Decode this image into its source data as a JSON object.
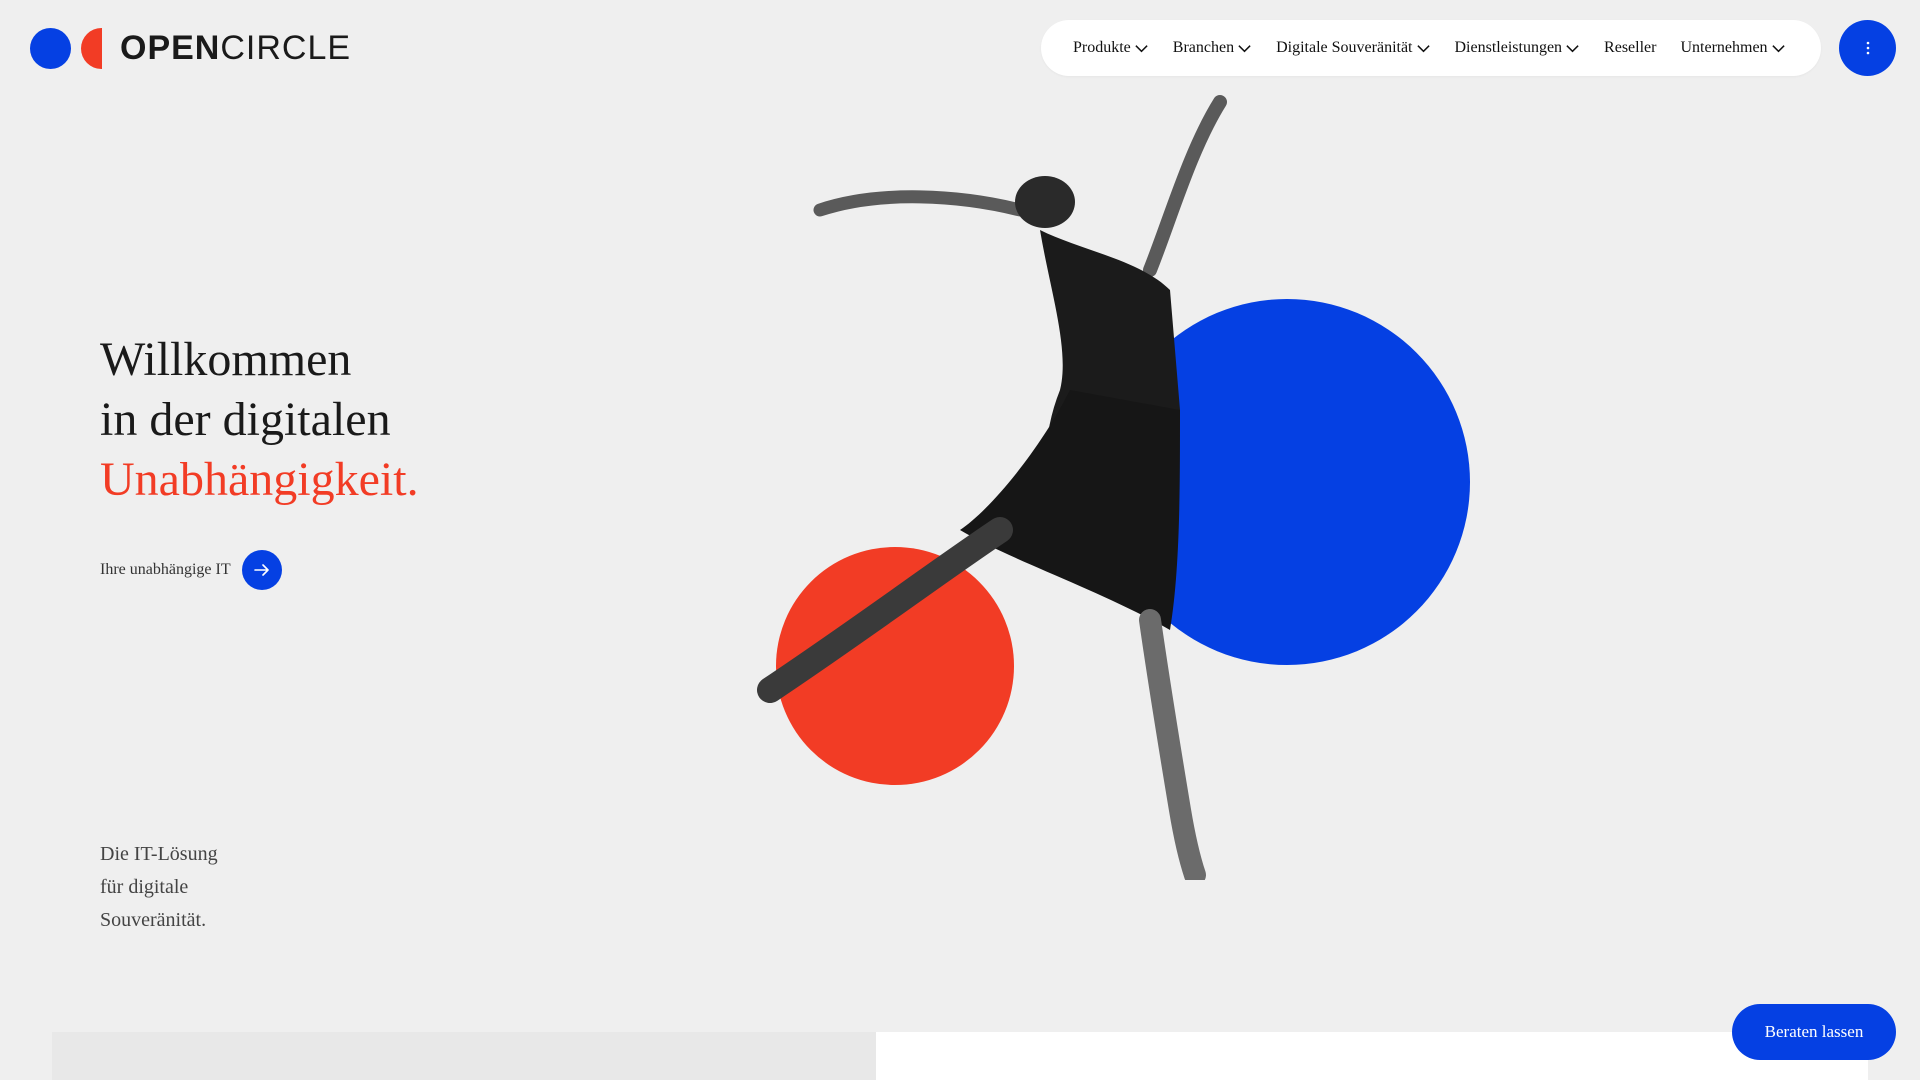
{
  "brand": {
    "name_bold": "OPEN",
    "name_regular": "CIRCLE",
    "blue": "#0540e3",
    "red": "#f23c25"
  },
  "nav": {
    "items": [
      {
        "label": "Produkte",
        "has_dropdown": true
      },
      {
        "label": "Branchen",
        "has_dropdown": true
      },
      {
        "label": "Digitale Souveränität",
        "has_dropdown": true
      },
      {
        "label": "Dienstleistungen",
        "has_dropdown": true
      },
      {
        "label": "Reseller",
        "has_dropdown": false
      },
      {
        "label": "Unternehmen",
        "has_dropdown": true
      }
    ],
    "menu_icon": "vertical-dots-icon"
  },
  "hero": {
    "title_line1": "Willkommen",
    "title_line2": "in der digitalen",
    "title_accent": "Unabhängigkeit.",
    "cta_label": "Ihre unabhängige IT",
    "cta_icon": "arrow-right-icon"
  },
  "tagline": {
    "line1": "Die IT-Lösung",
    "line2": "für digitale",
    "line3": "Souveränität."
  },
  "floating_button": {
    "label": "Beraten lassen"
  }
}
